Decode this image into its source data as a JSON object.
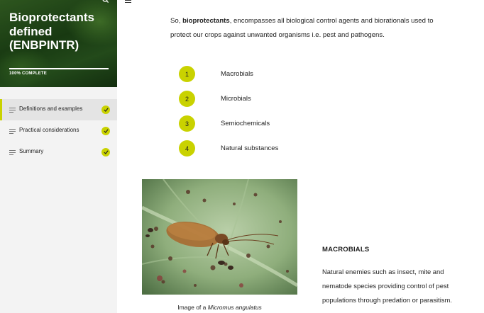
{
  "sidebar": {
    "course_title": "Bioprotectants defined (ENBPINTR)",
    "progress_label": "100% COMPLETE",
    "progress_fraction": 1.0,
    "items": [
      {
        "label": "Definitions and examples",
        "completed": true,
        "active": true
      },
      {
        "label": "Practical considerations",
        "completed": true,
        "active": false
      },
      {
        "label": "Summary",
        "completed": true,
        "active": false
      }
    ],
    "icons": {
      "search": "search-icon",
      "check": "check-circle-icon",
      "lesson": "lines-icon"
    }
  },
  "content": {
    "intro": {
      "prefix": "So, ",
      "bold": "bioprotectants",
      "suffix": ", encompasses all biological control agents and biorationals used to protect our crops against unwanted organisms i.e. pest and pathogens."
    },
    "list": [
      {
        "number": "1",
        "label": "Macrobials"
      },
      {
        "number": "2",
        "label": "Microbials"
      },
      {
        "number": "3",
        "label": "Semiochemicals"
      },
      {
        "number": "4",
        "label": "Natural substances"
      }
    ],
    "image_caption_prefix": "Image of a ",
    "image_caption_italic": "Micromus angulatus",
    "section_title": "MACROBIALS",
    "section_text": "Natural enemies such as insect, mite and nematode species providing control of pest populations through predation or parasitism."
  },
  "colors": {
    "accent": "#c9d200",
    "sidebar_bg": "#f3f3f3",
    "active_item_bg": "#e4e4e4"
  }
}
